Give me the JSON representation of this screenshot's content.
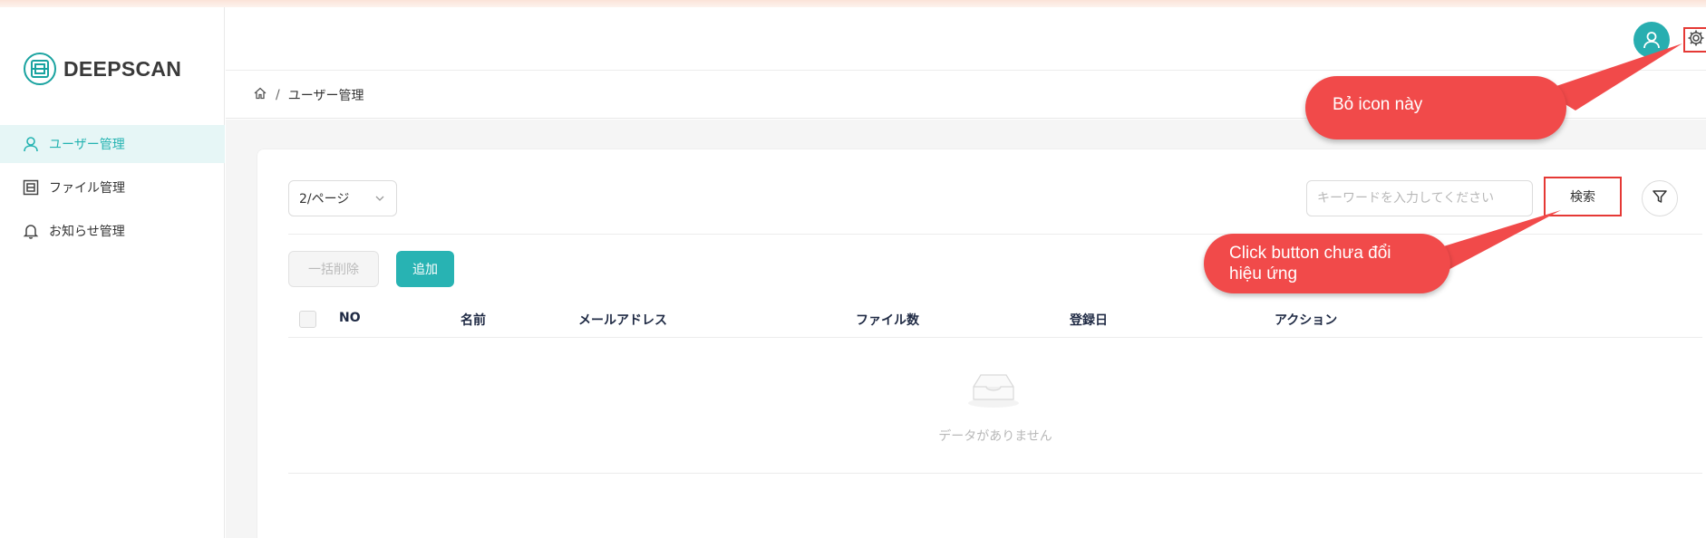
{
  "brand": {
    "name": "DEEPSCAN"
  },
  "sidebar": {
    "items": [
      {
        "label": "ユーザー管理",
        "icon": "user-icon",
        "active": true
      },
      {
        "label": "ファイル管理",
        "icon": "file-icon",
        "active": false
      },
      {
        "label": "お知らせ管理",
        "icon": "bell-icon",
        "active": false
      }
    ]
  },
  "header": {
    "avatar_icon": "user-avatar-icon",
    "settings_icon": "gear-icon"
  },
  "breadcrumb": {
    "home_icon": "home-icon",
    "separator": "/",
    "current": "ユーザー管理"
  },
  "toolbar": {
    "page_size": "2/ページ",
    "search_placeholder": "キーワードを入力してください",
    "search_label": "検索",
    "filter_icon": "filter-icon",
    "bulk_delete_label": "一括削除",
    "add_label": "追加"
  },
  "table": {
    "columns": [
      "NO",
      "名前",
      "メールアドレス",
      "ファイル数",
      "登録日",
      "アクション"
    ],
    "empty_text": "データがありません"
  },
  "annotations": [
    {
      "text": "Bỏ icon này"
    },
    {
      "text_line1": "Click button chưa đổi",
      "text_line2": "hiệu ứng"
    }
  ],
  "colors": {
    "accent": "#28b3b3",
    "annotation": "#f14a4a",
    "highlight_border": "#e53935"
  }
}
